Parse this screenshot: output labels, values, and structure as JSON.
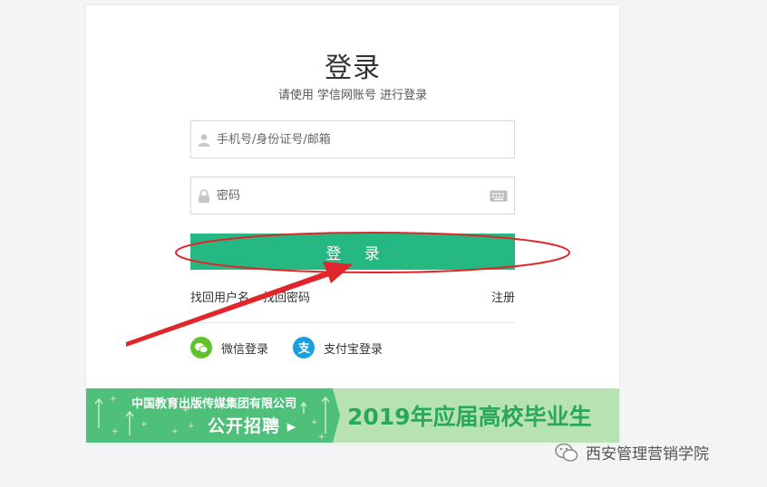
{
  "login": {
    "title": "登录",
    "subtitle": "请使用 学信网账号 进行登录",
    "username_placeholder": "手机号/身份证号/邮箱",
    "password_placeholder": "密码",
    "login_button": "登 录",
    "forgot_username": "找回用户名",
    "forgot_password": "找回密码",
    "register": "注册",
    "wechat_login": "微信登录",
    "alipay_login": "支付宝登录"
  },
  "banner": {
    "company": "中国教育出版传媒集团有限公司",
    "recruit": "公开招聘 ▸",
    "headline": "2019年应届高校毕业生"
  },
  "watermark": {
    "text": "西安管理营销学院"
  },
  "colors": {
    "primary": "#26b882",
    "annotation": "#e0262b",
    "wechat": "#62c22b",
    "alipay": "#1aa0e0"
  },
  "icons": [
    "user-icon",
    "lock-icon",
    "keyboard-icon",
    "wechat-icon",
    "alipay-icon",
    "wechat-watermark-icon"
  ]
}
